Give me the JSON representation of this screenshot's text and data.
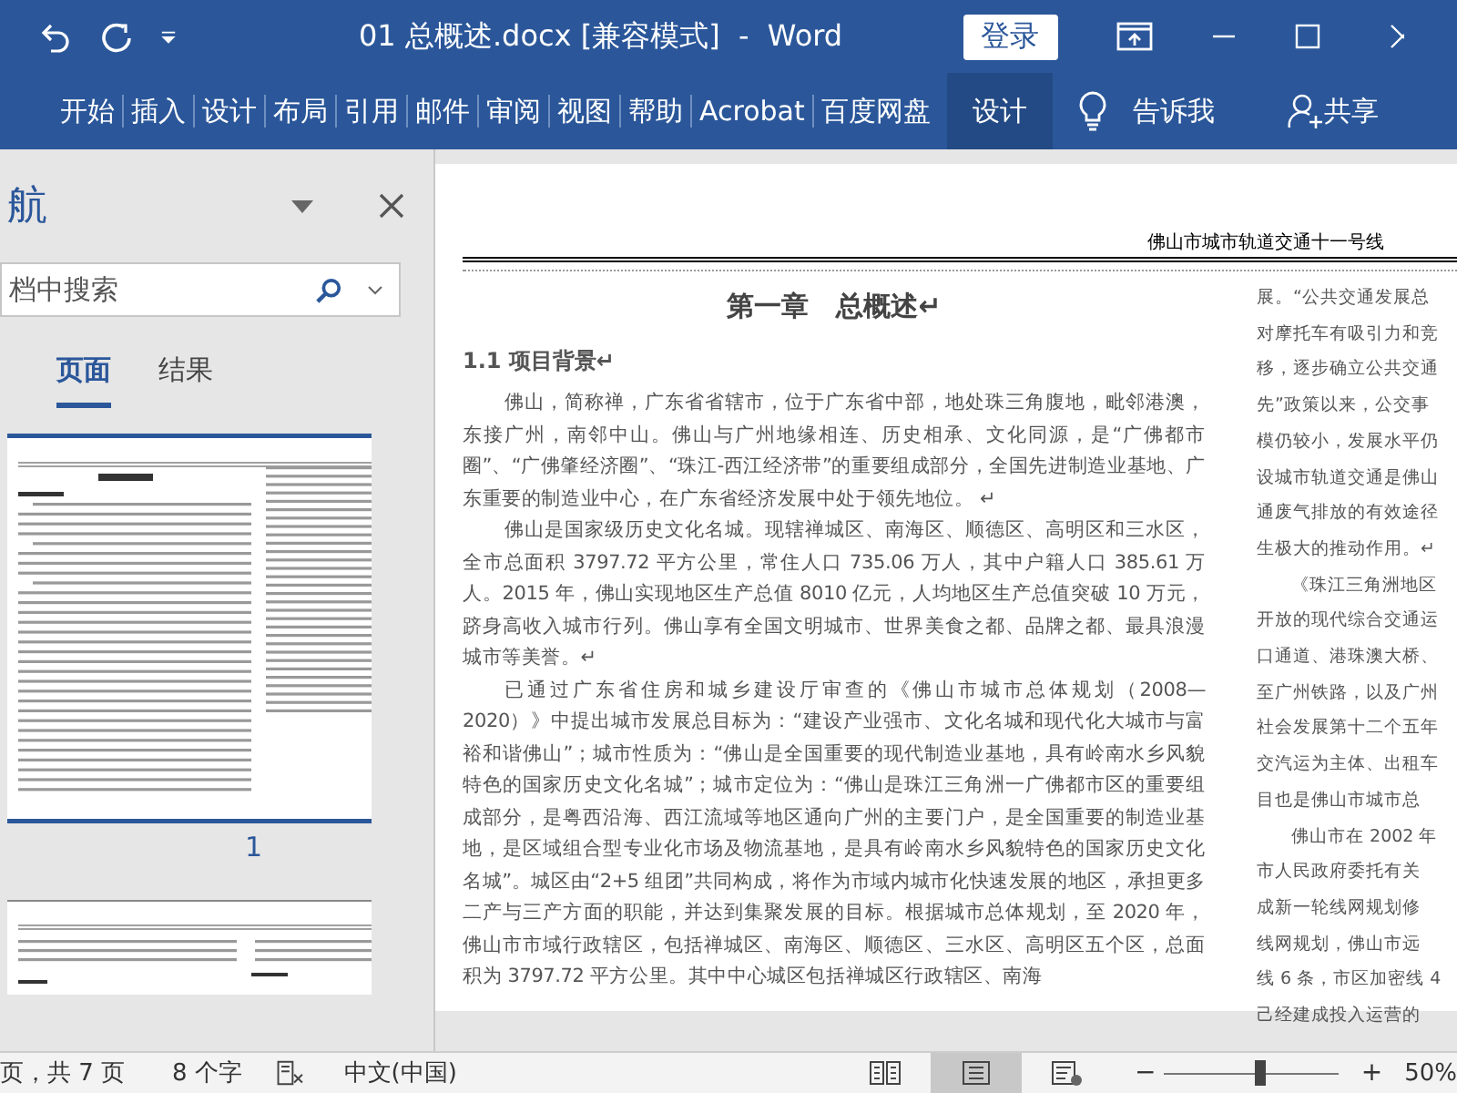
{
  "title_bar": {
    "title": "01 总概述.docx [兼容模式]  -  Word",
    "sign_in": "登录"
  },
  "ribbon": {
    "tabs": [
      {
        "label": "开始",
        "selected": false
      },
      {
        "label": "插入",
        "selected": false
      },
      {
        "label": "设计",
        "selected": false
      },
      {
        "label": "布局",
        "selected": false
      },
      {
        "label": "引用",
        "selected": false
      },
      {
        "label": "邮件",
        "selected": false
      },
      {
        "label": "审阅",
        "selected": false
      },
      {
        "label": "视图",
        "selected": false
      },
      {
        "label": "帮助",
        "selected": false
      },
      {
        "label": "Acrobat",
        "selected": false
      },
      {
        "label": "百度网盘",
        "selected": false
      },
      {
        "label": "设计",
        "selected": true
      }
    ],
    "tell_me": "告诉我",
    "share": "共享"
  },
  "nav_pane": {
    "title": "航",
    "search": {
      "placeholder": "档中搜索"
    },
    "tabs": [
      {
        "label": "页面",
        "selected": true
      },
      {
        "label": "结果",
        "selected": false
      }
    ],
    "page_number": "1"
  },
  "document": {
    "header": "佛山市城市轨道交通十一号线",
    "chapter_title": "第一章　总概述↵",
    "section_heading": "1.1 项目背景↵",
    "paragraphs": [
      "佛山，简称禅，广东省省辖市，位于广东省中部，地处珠三角腹地，毗邻港澳，东接广州，南邻中山。佛山与广州地缘相连、历史相承、文化同源，是“广佛都市圈”、“广佛肇经济圈”、“珠江-西江经济带”的重要组成部分，全国先进制造业基地、广东重要的制造业中心，在广东省经济发展中处于领先地位。 ↵",
      "佛山是国家级历史文化名城。现辖禅城区、南海区、顺德区、高明区和三水区，全市总面积 3797.72 平方公里，常住人口 735.06 万人，其中户籍人口 385.61 万人。2015 年，佛山实现地区生产总值 8010 亿元，人均地区生产总值突破 10 万元，跻身高收入城市行列。佛山享有全国文明城市、世界美食之都、品牌之都、最具浪漫城市等美誉。↵",
      "已通过广东省住房和城乡建设厅审查的《佛山市城市总体规划（2008—2020）》中提出城市发展总目标为：“建设产业强市、文化名城和现代化大城市与富裕和谐佛山”；城市性质为：“佛山是全国重要的现代制造业基地，具有岭南水乡风貌特色的国家历史文化名城”；城市定位为：“佛山是珠江三角洲一广佛都市区的重要组成部分，是粤西沿海、西江流域等地区通向广州的主要门户，是全国重要的制造业基地，是区域组合型专业化市场及物流基地，是具有岭南水乡风貌特色的国家历史文化名城”。城区由“2+5 组团”共同构成，将作为市域内城市化快速发展的地区，承担更多二产与三产方面的职能，并达到集聚发展的目标。根据城市总体规划，至 2020 年，佛山市市域行政辖区，包括禅城区、南海区、顺德区、三水区、高明区五个区，总面积为 3797.72 平方公里。其中中心城区包括禅城区行政辖区、南海"
    ],
    "right_column": [
      {
        "text": "展。“公共交通发展总",
        "indent": false
      },
      {
        "text": "对摩托车有吸引力和竞",
        "indent": false
      },
      {
        "text": "移，逐步确立公共交通",
        "indent": false
      },
      {
        "text": "先”政策以来，公交事",
        "indent": false
      },
      {
        "text": "模仍较小，发展水平仍",
        "indent": false
      },
      {
        "text": "设城市轨道交通是佛山",
        "indent": false
      },
      {
        "text": "通废气排放的有效途径",
        "indent": false
      },
      {
        "text": "生极大的推动作用。↵",
        "indent": false
      },
      {
        "text": "《珠江三角洲地区",
        "indent": true
      },
      {
        "text": "开放的现代综合交通运",
        "indent": false
      },
      {
        "text": "口通道、港珠澳大桥、",
        "indent": false
      },
      {
        "text": "至广州铁路，以及广州",
        "indent": false
      },
      {
        "text": "社会发展第十二个五年",
        "indent": false
      },
      {
        "text": "交汽运为主体、出租车",
        "indent": false
      },
      {
        "text": "目也是佛山市城市总",
        "indent": false
      },
      {
        "text": "佛山市在 2002 年",
        "indent": true
      },
      {
        "text": "市人民政府委托有关",
        "indent": false
      },
      {
        "text": "成新一轮线网规划修",
        "indent": false
      },
      {
        "text": "线网规划，佛山市远",
        "indent": false
      },
      {
        "text": "线 6 条，市区加密线 4",
        "indent": false
      },
      {
        "text": "己经建成投入运营的",
        "indent": false
      }
    ]
  },
  "status_bar": {
    "page": "页，共 7 页",
    "words": "8 个字",
    "language": "中文(中国)",
    "views": [
      {
        "kind": "read",
        "selected": false
      },
      {
        "kind": "print",
        "selected": true
      },
      {
        "kind": "web",
        "selected": false
      }
    ],
    "zoom_out": "−",
    "zoom_in": "+",
    "zoom": {
      "level": 0.55,
      "reading": "50%"
    }
  }
}
